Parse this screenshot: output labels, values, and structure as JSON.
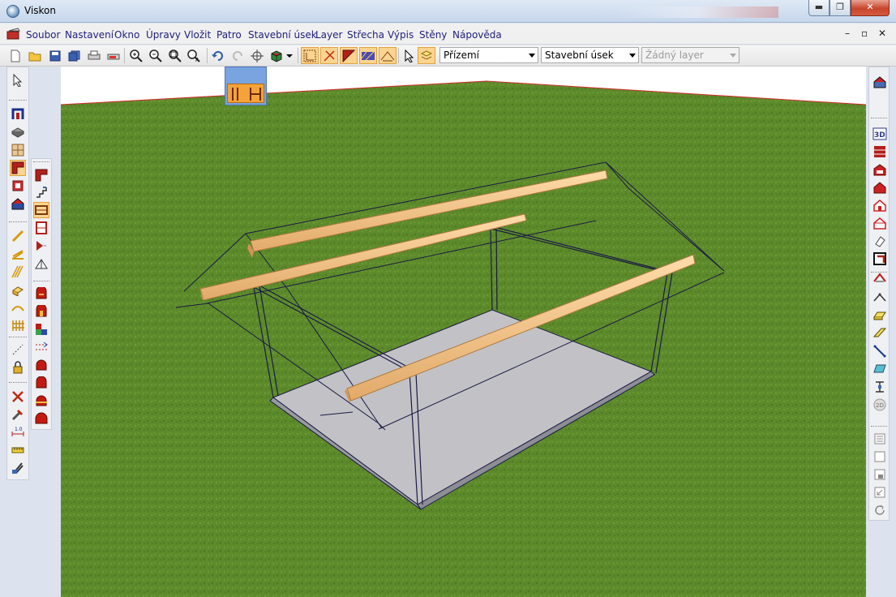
{
  "window": {
    "title": "Viskon",
    "min_symbol": "▬",
    "max_symbol": "❐",
    "close_symbol": "✕"
  },
  "menu": {
    "items": [
      "Soubor",
      "Nastavení",
      "Okno",
      "Úpravy",
      "Vložit",
      "Patro",
      "Stavební úsek",
      "Layer",
      "Střecha",
      "Výpis",
      "Stěny",
      "Nápověda"
    ],
    "mdi_min": "–",
    "mdi_restore": "▫",
    "mdi_close": "✕"
  },
  "toolbar": {
    "floor_select": "Přízemí",
    "section_select": "Stavební úsek",
    "layer_select": "Žádný layer"
  },
  "icons": {
    "toolbar": [
      "new-icon",
      "open-icon",
      "save-icon",
      "save-all-icon",
      "print-icon",
      "print-preview-icon",
      "zoom-in-icon",
      "zoom-out-icon",
      "zoom-window-icon",
      "zoom-all-icon",
      "undo-icon",
      "redo-icon",
      "pan-icon",
      "render-icon",
      "grid-icon",
      "snap-icon",
      "wall-corner-icon",
      "hatch-icon",
      "roof-tool-icon",
      "layer-icon",
      "select-arrow-icon"
    ],
    "colors": {
      "accent": "#fbd48f",
      "grass": "#5f8a2c",
      "beam": "#f2c58e",
      "floor": "#c2c2c7",
      "edge": "#1a1a44",
      "horizon": "#d12a2a"
    }
  }
}
